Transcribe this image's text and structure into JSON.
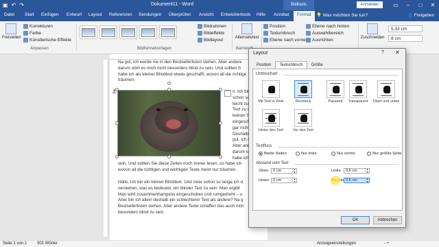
{
  "titlebar": {
    "qat_icons": [
      "save-icon",
      "undo-icon",
      "redo-icon"
    ],
    "title": "Dokument11 - Word",
    "context_band": "Bildtools",
    "signin": "Anmelden",
    "window_controls": [
      "minimize-icon",
      "maximize-icon",
      "close-icon"
    ]
  },
  "tabs": [
    "Datei",
    "Start",
    "Einfügen",
    "Entwurf",
    "Layout",
    "Referenzen",
    "Sendungen",
    "Überprüfen",
    "Ansicht",
    "Entwicklertools",
    "Hilfe",
    "Acrobat",
    "Format"
  ],
  "active_tab": "Format",
  "tell_me": "Was möchten Sie tun?",
  "share": "Freigeben",
  "ribbon": {
    "freistellen": "Freistellen",
    "korrekturen": "Korrekturen",
    "farbe": "Farbe",
    "kuenstlerisch": "Künstlerische Effekte",
    "anpassen_label": "Anpassen",
    "bildformatvorlagen_label": "Bildformatvorlagen",
    "bildrahmen": "Bildrahmen",
    "bildeffekte": "Bildeffekte",
    "bildlayout": "Bildlayout",
    "alternativtext": "Alternativtext",
    "barrierefreiheit_label": "Barrierefr...",
    "position": "Position",
    "textumbruch": "Textumbruch",
    "ebene_vorne": "Ebene nach vorne",
    "ebene_hinten": "Ebene nach hinten",
    "auswahlbereich": "Auswahlbereich",
    "ausrichten": "Ausrichten",
    "zuschneiden": "Zuschneiden",
    "height_value": "5,33 cm",
    "width_value": "8 cm"
  },
  "document": {
    "para_top": [
      "Na gut, ich werde nie in den Bestsellerlisten stehen. Aber andere",
      "darum stört es mich nicht besonders blind zu sein. Und sollten S",
      "habe ich als kleiner Blindtext etwas geschafft, wovon all die richtige",
      "träumen."
    ],
    "para_right": [
      "n. Ich bin",
      "schon so lan",
      "leicht zu ver",
      "Text zu sein",
      "keinen Sinn.",
      "eingeschobe",
      "gar nicht ers",
      "Deshalb ein",
      "gut, ich wer",
      "Aber ander",
      "darum stör",
      "habe ich als"
    ],
    "para_under": [
      "sein. Und sollten Sie diese Zeilen noch immer lesen, so habe ich",
      "wovon all die richtigen und wichtigen Texte meist nur träumen."
    ],
    "para_bottom": [
      "Hallo. Ich bin ein kleiner Blindtext. Und zwar schon so lange ich d",
      "verstehen, was es bedeutet, ein blinder Text zu sein: Man ergibt",
      "Man wird zusammenhangslos eingeschoben und rumgedreht – u",
      "Aber bin ich allein deshalb ein schlechterer Text als andere? Na g",
      "Bestsellerlisten stehen. Aber andere Texte schaffen das auch nich",
      "besonders blind zu sein."
    ]
  },
  "status": {
    "page": "Seite 1 von 1",
    "words": "301 Wörter",
    "display_settings": "Anzeigeeinstellungen",
    "zoom": "-  +"
  },
  "dialog": {
    "title": "Layout",
    "help": "?",
    "close": "✕",
    "tabs": [
      "Position",
      "Textumbruch",
      "Größe"
    ],
    "active_tab": "Textumbruch",
    "section_wrap": "Umbruchart",
    "wrap_options": [
      {
        "label": "Mit Text in Zeile",
        "icon": "inline-wrap-icon",
        "selected": false
      },
      {
        "label": "Rechteck",
        "icon": "square-wrap-icon",
        "selected": true
      },
      {
        "label": "Passend",
        "icon": "tight-wrap-icon",
        "selected": false
      },
      {
        "label": "Transparent",
        "icon": "through-wrap-icon",
        "selected": false
      },
      {
        "label": "Oben und unten",
        "icon": "top-bottom-wrap-icon",
        "selected": false
      },
      {
        "label": "Hinter den Text",
        "icon": "behind-text-icon",
        "selected": false
      },
      {
        "label": "Vor den Text",
        "icon": "in-front-text-icon",
        "selected": false
      }
    ],
    "section_flow": "Textfluss",
    "flow_options": [
      {
        "label": "Beide Seiten",
        "selected": true
      },
      {
        "label": "Nur links",
        "selected": false
      },
      {
        "label": "Nur rechts",
        "selected": false
      },
      {
        "label": "Nur größte Seite",
        "selected": false
      }
    ],
    "section_distance": "Abstand vom Text",
    "distance": {
      "oben_label": "Oben",
      "oben_value": "0 cm",
      "unten_label": "Unten",
      "unten_value": "0 cm",
      "links_label": "Links",
      "links_value": "0,5 cm",
      "rechts_label": "Rechts",
      "rechts_value": "0,5 cm"
    },
    "ok": "OK",
    "cancel": "Abbrechen"
  },
  "colors": {
    "accent": "#2b579a",
    "selection": "#3c8ad6"
  }
}
